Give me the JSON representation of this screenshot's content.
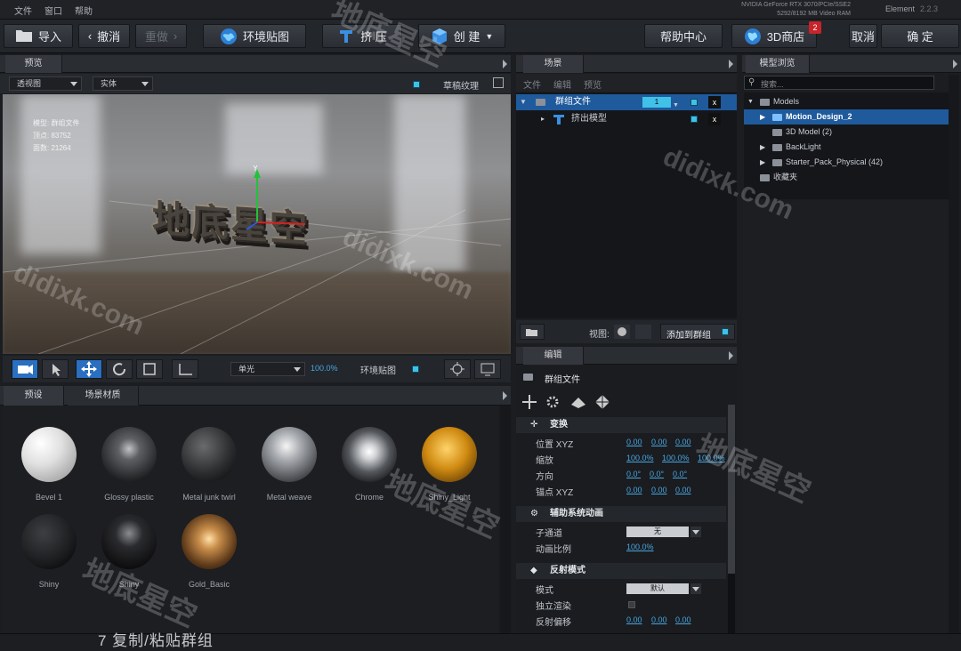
{
  "menu": {
    "file": "文件",
    "window": "窗口",
    "help": "帮助"
  },
  "system": {
    "gpu_line1": "NVIDIA GeForce RTX 3070/PCIe/SSE2",
    "gpu_line2": "5292/8192 MB Video RAM",
    "app": "Element",
    "version": "2.2.3"
  },
  "toolbar": {
    "import": "导入",
    "undo": "撤消",
    "redo": "重做",
    "env_map": "环境贴图",
    "extrude": "挤 压",
    "create": "创 建",
    "help_center": "帮助中心",
    "store": "3D商店",
    "store_badge": "2",
    "cancel": "取消",
    "ok": "确 定"
  },
  "preview": {
    "tab": "预览",
    "view_mode": "透视图",
    "render_mode": "实体",
    "draft_texture": "草稿纹理",
    "info_model": "模型: 群组文件",
    "info_vertices": "顶点: 83752",
    "info_faces": "面数: 21264",
    "text3d": "地底星空"
  },
  "viewport_tools": {
    "light": "单光",
    "percent": "100.0%",
    "env_map": "环境贴图"
  },
  "scene": {
    "tab": "场景",
    "menu_file": "文件",
    "menu_edit": "编辑",
    "menu_preview": "预览",
    "group": "群组文件",
    "group_num": "1",
    "child": "挤出模型",
    "view_label": "视图:",
    "add_to_group": "添加到群组"
  },
  "edit": {
    "tab": "编辑",
    "header": "群组文件",
    "transform": "变换",
    "position": "位置 XYZ",
    "position_vals": [
      "0.00",
      "0.00",
      "0.00"
    ],
    "scale": "缩放",
    "scale_vals": [
      "100.0%",
      "100.0%",
      "100.0%"
    ],
    "orientation": "方向",
    "orientation_vals": [
      "0.0°",
      "0.0°",
      "0.0°"
    ],
    "anchor": "锚点 XYZ",
    "anchor_vals": [
      "0.00",
      "0.00",
      "0.00"
    ],
    "aux_anim": "辅助系统动画",
    "channel": "子通道",
    "channel_val": "无",
    "anim_ratio": "动画比例",
    "anim_ratio_val": "100.0%",
    "reflection": "反射模式",
    "mode": "模式",
    "mode_val": "默认",
    "independent": "独立渲染",
    "reflection_offset": "反射偏移",
    "reflection_vals": [
      "0.00",
      "0.00",
      "0.00"
    ]
  },
  "model_browser": {
    "tab": "模型浏览",
    "search_placeholder": "搜索...",
    "root": "Models",
    "items": [
      "Motion_Design_2",
      "3D Model (2)",
      "BackLight",
      "Starter_Pack_Physical (42)"
    ],
    "favorites": "收藏夹"
  },
  "presets": {
    "tab_presets": "预设",
    "tab_scene_materials": "场景材质",
    "materials": [
      "Bevel 1",
      "Glossy plastic",
      "Metal junk twirl",
      "Metal weave",
      "Chrome",
      "Shiny_Light",
      "Shiny",
      "Shiny",
      "Gold_Basic"
    ]
  },
  "watermark": {
    "cn": "地底星空",
    "url": "didixk.com"
  },
  "bottom_caption": "7  复制/粘贴群组",
  "colors": {
    "accent": "#2a6fc0",
    "selection": "#1f5a9c",
    "link": "#48a6e0",
    "checkbox": "#3fc1e8",
    "badge": "#c8242a"
  }
}
